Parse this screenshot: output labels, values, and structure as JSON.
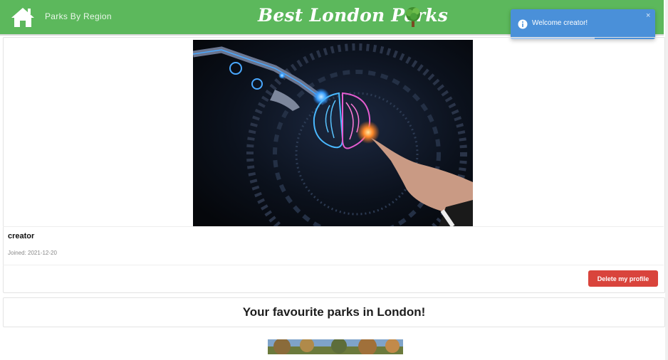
{
  "navbar": {
    "home_icon": "home-icon",
    "region_link": "Parks By Region",
    "brand_title": "Best London Parks",
    "brand_icon": "tree-icon",
    "color": "#5cb85c"
  },
  "toast": {
    "message": "Welcome creator!",
    "icon": "info-icon",
    "close": "×",
    "color": "#4a90d9",
    "progress": 0.58
  },
  "profile": {
    "username": "creator",
    "joined": "Joined: 2021-12-20",
    "delete_label": "Delete my profile",
    "image": "ai-brain-illustration"
  },
  "favourites": {
    "title": "Your favourite parks in London!"
  }
}
